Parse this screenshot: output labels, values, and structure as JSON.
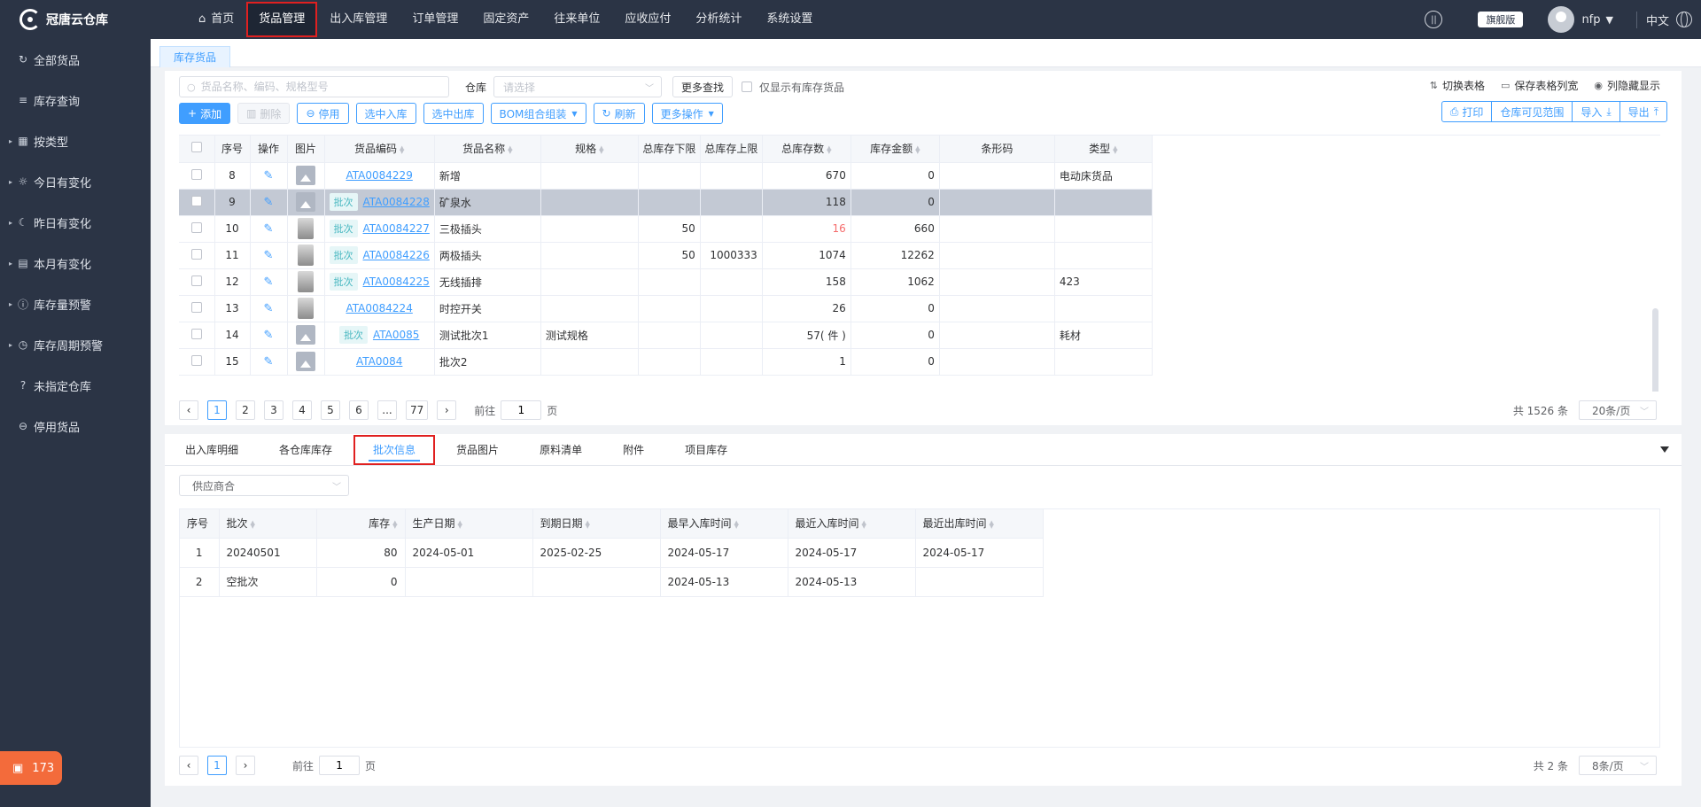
{
  "app": {
    "logo_text": "冠唐云仓库"
  },
  "sidebar": {
    "items": [
      {
        "label": "全部货品",
        "icon": "refresh-icon",
        "arrow": false
      },
      {
        "label": "库存查询",
        "icon": "list-icon",
        "arrow": false
      },
      {
        "label": "按类型",
        "icon": "grid-icon",
        "arrow": true
      },
      {
        "label": "今日有变化",
        "icon": "sun-icon",
        "arrow": true
      },
      {
        "label": "昨日有变化",
        "icon": "moon-icon",
        "arrow": true
      },
      {
        "label": "本月有变化",
        "icon": "calendar-icon",
        "arrow": true
      },
      {
        "label": "库存量预警",
        "icon": "alert-icon",
        "arrow": true
      },
      {
        "label": "库存周期预警",
        "icon": "clock-icon",
        "arrow": true
      },
      {
        "label": "未指定仓库",
        "icon": "question-icon",
        "arrow": false
      },
      {
        "label": "停用货品",
        "icon": "minus-circle-icon",
        "arrow": false
      }
    ],
    "badge_count": "173"
  },
  "topnav": {
    "items": [
      "首页",
      "货品管理",
      "出入库管理",
      "订单管理",
      "固定资产",
      "往来单位",
      "应收应付",
      "分析统计",
      "系统设置"
    ],
    "edition": "旗舰版",
    "user": "nfp",
    "lang": "中文"
  },
  "page_tab": "库存货品",
  "filters": {
    "search_placeholder": "货品名称、编码、规格型号",
    "warehouse_label": "仓库",
    "warehouse_placeholder": "请选择",
    "more_search": "更多查找",
    "only_stock": "仅显示有库存货品"
  },
  "right_tools": [
    "切换表格",
    "保存表格列宽",
    "列隐藏显示"
  ],
  "actions": {
    "add": "添加",
    "delete": "删除",
    "disable": "停用",
    "to_in": "选中入库",
    "to_out": "选中出库",
    "bom": "BOM组合组装",
    "refresh": "刷新",
    "more": "更多操作"
  },
  "btn_group": [
    "打印",
    "仓库可见范围",
    "导入",
    "导出"
  ],
  "grid": {
    "headers": [
      "序号",
      "操作",
      "图片",
      "货品编码",
      "货品名称",
      "规格",
      "总库存下限",
      "总库存上限",
      "总库存数",
      "库存金额",
      "条形码",
      "类型"
    ],
    "batch_tag": "批次",
    "rows": [
      {
        "no": "8",
        "img": "ph",
        "batch": false,
        "code": "ATA0084229",
        "name": "新增",
        "spec": "",
        "min": "",
        "max": "",
        "qty": "670",
        "red": false,
        "amount": "0",
        "barcode": "",
        "type": "电动床货品",
        "sel": false
      },
      {
        "no": "9",
        "img": "ph",
        "batch": true,
        "code": "ATA0084228",
        "name": "矿泉水",
        "spec": "",
        "min": "",
        "max": "",
        "qty": "118",
        "red": false,
        "amount": "0",
        "barcode": "",
        "type": "",
        "sel": true
      },
      {
        "no": "10",
        "img": "prod",
        "batch": true,
        "code": "ATA0084227",
        "name": "三极插头",
        "spec": "",
        "min": "50",
        "max": "",
        "qty": "16",
        "red": true,
        "amount": "660",
        "barcode": "",
        "type": "",
        "sel": false
      },
      {
        "no": "11",
        "img": "prod",
        "batch": true,
        "code": "ATA0084226",
        "name": "两极插头",
        "spec": "",
        "min": "50",
        "max": "1000333",
        "qty": "1074",
        "red": false,
        "amount": "12262",
        "barcode": "",
        "type": "",
        "sel": false
      },
      {
        "no": "12",
        "img": "prod",
        "batch": true,
        "code": "ATA0084225",
        "name": "无线插排",
        "spec": "",
        "min": "",
        "max": "",
        "qty": "158",
        "red": false,
        "amount": "1062",
        "barcode": "",
        "type": "423",
        "sel": false
      },
      {
        "no": "13",
        "img": "prod",
        "batch": false,
        "code": "ATA0084224",
        "name": "时控开关",
        "spec": "",
        "min": "",
        "max": "",
        "qty": "26",
        "red": false,
        "amount": "0",
        "barcode": "",
        "type": "",
        "sel": false
      },
      {
        "no": "14",
        "img": "ph",
        "batch": true,
        "code": "ATA0085",
        "name": "测试批次1",
        "spec": "测试规格",
        "min": "",
        "max": "",
        "qty": "57( 件 )",
        "red": false,
        "amount": "0",
        "barcode": "",
        "type": "耗材",
        "sel": false
      },
      {
        "no": "15",
        "img": "ph",
        "batch": false,
        "code": "ATA0084",
        "name": "批次2",
        "spec": "",
        "min": "",
        "max": "",
        "qty": "1",
        "red": false,
        "amount": "0",
        "barcode": "",
        "type": "",
        "sel": false
      }
    ]
  },
  "pager1": {
    "pages": [
      "1",
      "2",
      "3",
      "4",
      "5",
      "6",
      "...",
      "77"
    ],
    "goto_prefix": "前往",
    "goto_value": "1",
    "goto_suffix": "页",
    "total": "共 1526 条",
    "page_size": "20条/页"
  },
  "bottom_tabs": [
    "出入库明细",
    "各仓库库存",
    "批次信息",
    "货品图片",
    "原料清单",
    "附件",
    "项目库存"
  ],
  "bottom_active": 2,
  "supplier_select": "供应商合",
  "batch_grid": {
    "headers": [
      "序号",
      "批次",
      "库存",
      "生产日期",
      "到期日期",
      "最早入库时间",
      "最近入库时间",
      "最近出库时间"
    ],
    "rows": [
      [
        "1",
        "20240501",
        "80",
        "2024-05-01",
        "2025-02-25",
        "2024-05-17",
        "2024-05-17",
        "2024-05-17"
      ],
      [
        "2",
        "空批次",
        "0",
        "",
        "",
        "2024-05-13",
        "2024-05-13",
        ""
      ]
    ]
  },
  "pager2": {
    "page": "1",
    "goto_prefix": "前往",
    "goto_value": "1",
    "goto_suffix": "页",
    "total": "共 2 条",
    "page_size": "8条/页"
  }
}
